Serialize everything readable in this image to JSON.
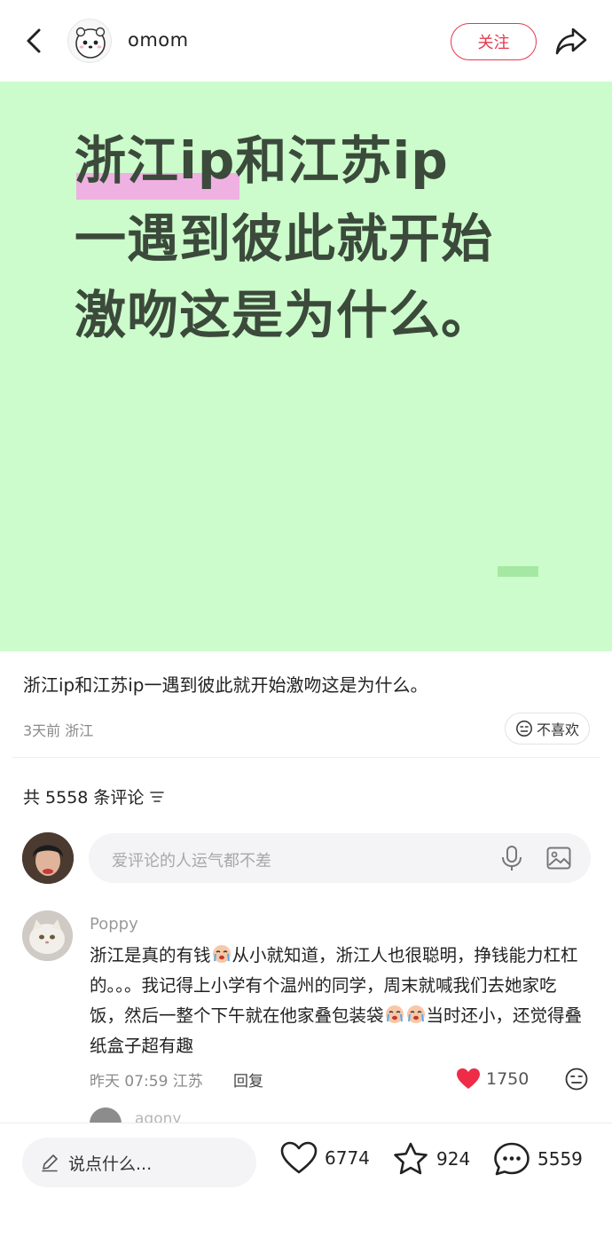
{
  "header": {
    "username": "omom",
    "follow_label": "关注"
  },
  "post": {
    "image_lines": [
      "浙江ip和江苏ip",
      "一遇到彼此就开始",
      "激吻这是为什么。"
    ],
    "caption": "浙江ip和江苏ip一遇到彼此就开始激吻这是为什么。",
    "meta": "3天前 浙江",
    "dislike_label": "不喜欢"
  },
  "comments": {
    "count_label": "共 5558 条评论",
    "input_placeholder": "爱评论的人运气都不差",
    "items": [
      {
        "name": "Poppy",
        "text_parts": [
          "浙江是真的有钱",
          "从小就知道，浙江人也很聪明，挣钱能力杠杠的。。。我记得上小学有个温州的同学，周末就喊我们去她家吃饭，然后一整个下午就在他家叠包装袋",
          "当时还小，还觉得叠纸盒子超有趣"
        ],
        "meta": "昨天 07:59 江苏",
        "reply_label": "回复",
        "likes": "1750"
      }
    ],
    "sub_reply_name": "agony"
  },
  "bottom_bar": {
    "say_placeholder": "说点什么...",
    "likes": "6774",
    "favorites": "924",
    "comments": "5559"
  },
  "colors": {
    "accent": "#e5384e",
    "post_bg": "#ccfccb",
    "post_text": "#3b4a3b",
    "highlight": "#f5a3e6"
  }
}
